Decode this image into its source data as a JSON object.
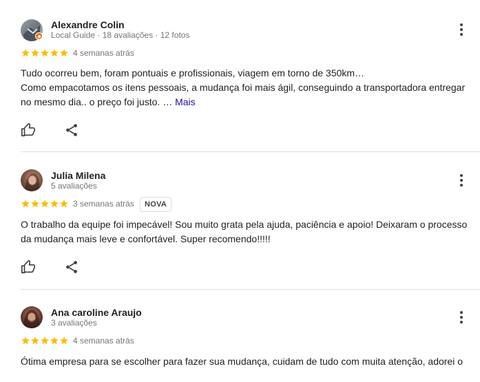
{
  "reviews": [
    {
      "author": "Alexandre Colin",
      "meta": "Local Guide · 18 avaliações · 12 fotos",
      "rating": 5,
      "date": "4 semanas atrás",
      "text_line1": "Tudo ocorreu bem, foram pontuais e profissionais, viagem em torno de 350km…",
      "text_line2": "Como empacotamos os itens pessoais, a mudança foi mais ágil, conseguindo a transportadora entregar",
      "text_line3": "no mesmo dia.. o preço foi justo. …",
      "more_label": "Mais",
      "avatar_icon": "local-guide-avatar"
    },
    {
      "author": "Julia Milena",
      "meta": "5 avaliações",
      "rating": 5,
      "date": "3 semanas atrás",
      "tag": "NOVA",
      "text_line1": "O trabalho da equipe foi impecável! Sou muito grata pela ajuda, paciência e apoio! Deixaram o processo",
      "text_line2": "da mudança mais leve e confortável. Super recomendo!!!!!",
      "avatar_icon": "user-photo-avatar"
    },
    {
      "author": "Ana caroline Araujo",
      "meta": "3 avaliações",
      "rating": 5,
      "date": "4 semanas atrás",
      "text_line1": "Ótima empresa para se escolher para fazer sua mudança, cuidam de tudo com muita atenção, adorei o",
      "avatar_icon": "user-photo-avatar"
    }
  ],
  "colors": {
    "star": "#fbbc04",
    "link": "#1a0dab",
    "divider": "#dadce0",
    "local_guide_badge": "#e8710a"
  },
  "icons": {
    "like": "thumbs-up-icon",
    "share": "share-icon",
    "menu": "more-vert-icon"
  }
}
